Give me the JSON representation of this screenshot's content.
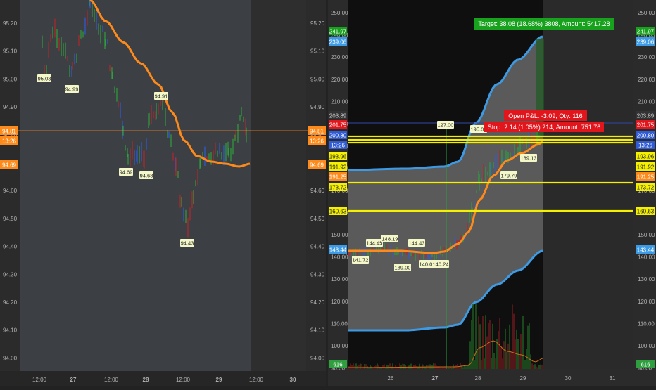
{
  "colors": {
    "background": "#2b2b2b",
    "plot_left": "#3c3f44",
    "plot_left_future": "#2e2e2e",
    "plot_right": "#0f0f0f",
    "up_bar": "#2e9e3f",
    "down_bar": "#b3262b",
    "blue_bar": "#2f5bd6",
    "ma_orange": "#ff8a1c",
    "band_blue": "#3d9be5",
    "yellow": "#f4f000",
    "target_green": "#17a11d",
    "stop_red": "#e0161c",
    "price_line": "#ff8a1c",
    "axis_text": "#b0b0b0"
  },
  "left_chart": {
    "y_axis_ticks": [
      "95.20",
      "95.10",
      "95.00",
      "94.90",
      "94.80",
      "94.70",
      "94.60",
      "94.50",
      "94.40",
      "94.30",
      "94.20",
      "94.10",
      "94.00"
    ],
    "x_axis_ticks": [
      "12:00",
      "27",
      "12:00",
      "28",
      "12:00",
      "29",
      "12:00",
      "30"
    ],
    "price_labels": [
      "95.03",
      "94.99",
      "94.91",
      "94.69",
      "94.68",
      "94.43"
    ],
    "current_price": "94.81",
    "time_to_close": "13:26",
    "ma_value": "94.69"
  },
  "right_chart": {
    "y_axis_ticks": [
      "250.00",
      "240.00",
      "230.00",
      "220.00",
      "210.00",
      "200.00",
      "190.00",
      "180.00",
      "170.00",
      "160.00",
      "150.00",
      "140.00",
      "130.00",
      "120.00",
      "110.00",
      "100.00",
      "90.00"
    ],
    "x_axis_ticks": [
      "26",
      "27",
      "28",
      "29",
      "30",
      "31"
    ],
    "badges": {
      "upper_band": "241.97",
      "upper_band_2": "239.06",
      "top_gray": "203.89",
      "current_price": "201.75",
      "entry": "200.80",
      "time_to_close": "13:26",
      "yellow_1": "193.96",
      "yellow_2": "191.92",
      "ma": "191.25",
      "yellow_3": "173.72",
      "yellow_4": "160.63",
      "lower_band": "143.44",
      "volume": "616"
    },
    "target_label": "Target: 38.08 (18.68%) 3808, Amount: 5417.28",
    "open_pnl_label": "Open P&L: -3.09, Qty: 116",
    "stop_label": "Stop: 2.14 (1.05%) 214, Amount: 751.76",
    "price_labels": [
      "127.00",
      "195.08",
      "189.13",
      "179.79",
      "144.43",
      "144.45",
      "148.19",
      "141.72",
      "139.00",
      "140.01",
      "140.24"
    ]
  }
}
